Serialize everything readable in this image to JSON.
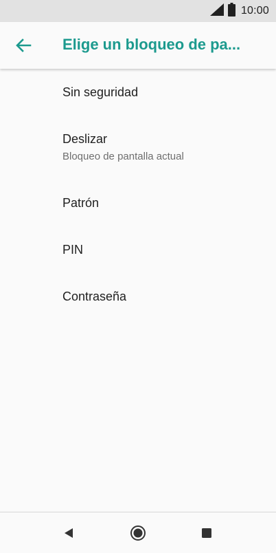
{
  "status_bar": {
    "time": "10:00",
    "icons": [
      "signal-icon",
      "battery-icon"
    ]
  },
  "header": {
    "title": "Elige un bloqueo de pa...",
    "back_icon": "back-arrow-icon",
    "accent_color": "#1c9a8e"
  },
  "options": [
    {
      "title": "Sin seguridad"
    },
    {
      "title": "Deslizar",
      "subtitle": "Bloqueo de pantalla actual"
    },
    {
      "title": "Patrón"
    },
    {
      "title": "PIN"
    },
    {
      "title": "Contraseña"
    }
  ],
  "nav_bar": {
    "icons": [
      "back-triangle-icon",
      "home-circle-icon",
      "recents-square-icon"
    ]
  }
}
